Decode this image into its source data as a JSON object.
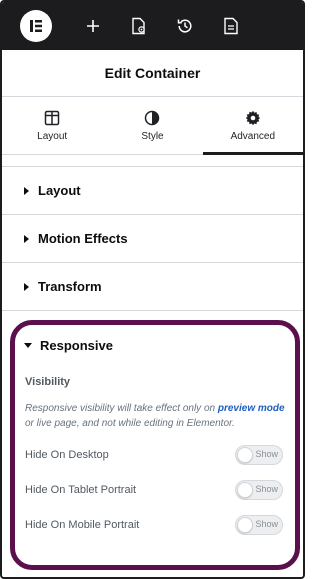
{
  "panel": {
    "title": "Edit Container"
  },
  "tabs": [
    {
      "label": "Layout",
      "icon": "columns-icon"
    },
    {
      "label": "Style",
      "icon": "contrast-icon"
    },
    {
      "label": "Advanced",
      "icon": "gear-icon",
      "active": true
    }
  ],
  "sections": [
    {
      "title": "Layout"
    },
    {
      "title": "Motion Effects"
    },
    {
      "title": "Transform"
    }
  ],
  "responsive": {
    "title": "Responsive",
    "visibility_label": "Visibility",
    "help_prefix": "Responsive visibility will take effect only on ",
    "help_link": "preview mode",
    "help_suffix": " or live page, and not while editing in Elementor.",
    "toggles": [
      {
        "label": "Hide On Desktop",
        "state": "Show"
      },
      {
        "label": "Hide On Tablet Portrait",
        "state": "Show"
      },
      {
        "label": "Hide On Mobile Portrait",
        "state": "Show"
      }
    ]
  },
  "colors": {
    "highlight": "#5b0f4c",
    "topbar": "#1c1c1e",
    "link": "#1f5fbf"
  }
}
